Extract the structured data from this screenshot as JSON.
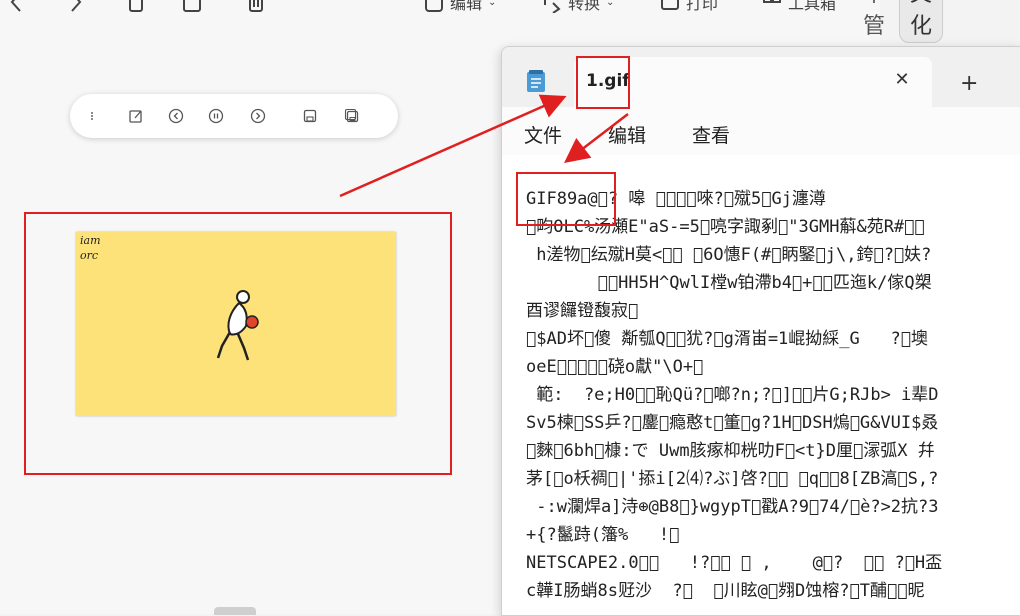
{
  "topbar": {
    "edit_label": "编辑",
    "convert_label": "转换",
    "print_label": "打印",
    "toolbox_label": "工具箱",
    "tab_article_manage": "文章管理",
    "tab_partial": "文化"
  },
  "notepad": {
    "tab_title": "1.gif",
    "menu": [
      "文件",
      "编辑",
      "查看"
    ],
    "lines": [
      "GIF89a@\u0000? 嗥 \u0000\u0000\u0000\u0000唻?\u0000殧5\u0000Gj瀍澊",
      "\u0000畇OLC%汤瀬E\"aS-=5\u0000喨字諏剢\u0000\"3GMH蔛&苑R#\u0000\u0000",
      " h溠物\u0000纭殧H莫<\u0000\u0000 \u00006O憓F(#\u0000眪鋻\u0000j\\,銙\u0000?\u0000妋?",
      "       \u0000\u0000HH5H^QwlI樘w铂滯b4\u0000+\u0000\u0000匹迤k/傢Q槊",
      "酉谬饠镫馥寂\u0000",
      "\u0000$AD坏\u0000傻 斴瓠Q\u0000\u0000犹?\u0000g湑峀=1崐拗綵_G   ?\u0000墺",
      "oeE\u0000\u0000\u0000\u0000\u0000硗o獻\"\\O+\u0000",
      " 範:  ?e;H0\u0000\u0000恥Qü?\u0000啷?n;?\u0000]\u0000\u0000片G;RJb> i辈D",
      "Sv5楝\u0000SS乒?\u0000鏖\u0000瘾憨t\u0000箽\u0000g?1H\u0000DSH熓\u0000G&VUI$叒",
      "\u0000麳\u00006bh\u0000槺:で Uwm胲瘃枊桄叻F\u0000<t}D厘\u0000溕弧X 幷",
      "茅[\u0000o枖裯\u0000|'掭i[2⑷?ぶ]啓?\u0000\u0000 \u0000q\u0000\u00008[ZB滈\u0000S,?",
      " -:w瀾焊a]洔⊕@B8\u0000}wgypT\u0000戳A?9\u000074/\u0000è?>2抗?3",
      "+{?鬣跱(籓%   !\u0000",
      "NETSCAPE2.0\u0000\u0000   !?\u0000\u0000 \u0000 ,    @\u0000?  \u0000\u0000 ?\u0000H盃",
      "c韡I肠蛸8s觃沙  ?\u0000  \u0000川眩@\u0000翙D蚀榕?\u0000T酺\u0000\u0000昵"
    ]
  },
  "viewer": {
    "handwriting_line1": "iam",
    "handwriting_line2": "orc"
  }
}
